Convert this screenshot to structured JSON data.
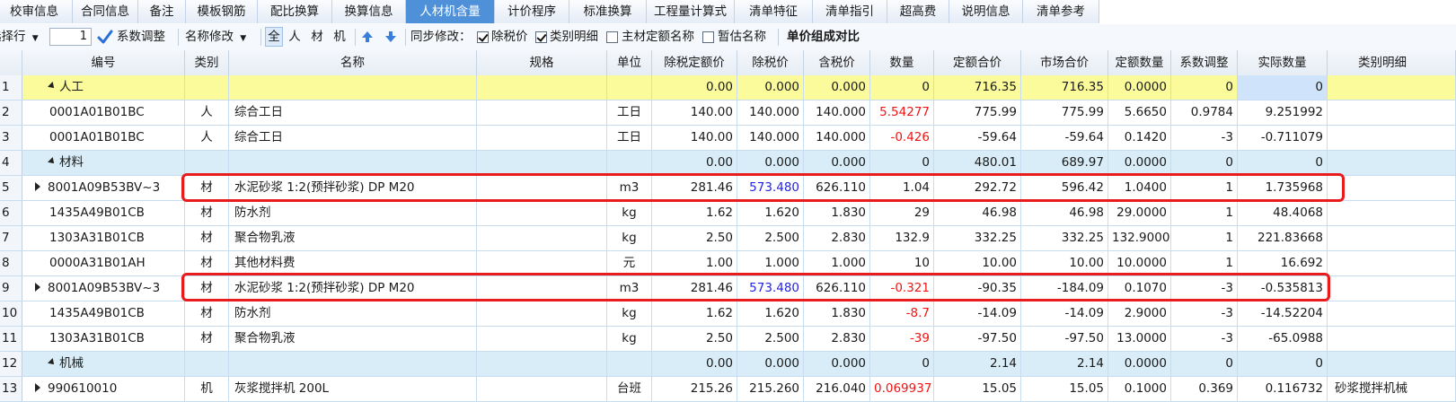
{
  "tabs": [
    {
      "label": "校审信息",
      "active": false
    },
    {
      "label": "合同信息",
      "active": false
    },
    {
      "label": "备注",
      "active": false
    },
    {
      "label": "模板钢筋",
      "active": false
    },
    {
      "label": "配比换算",
      "active": false
    },
    {
      "label": "换算信息",
      "active": false
    },
    {
      "label": "人材机含量",
      "active": true
    },
    {
      "label": "计价程序",
      "active": false
    },
    {
      "label": "标准换算",
      "active": false
    },
    {
      "label": "工程量计算式",
      "active": false
    },
    {
      "label": "清单特征",
      "active": false
    },
    {
      "label": "清单指引",
      "active": false
    },
    {
      "label": "超高费",
      "active": false
    },
    {
      "label": "说明信息",
      "active": false
    },
    {
      "label": "清单参考",
      "active": false
    }
  ],
  "toolbar": {
    "select_row_label": "选择行",
    "spin_value": "1",
    "coef_adjust_label": "系数调整",
    "rename_label": "名称修改",
    "filters": [
      "全",
      "人",
      "材",
      "机"
    ],
    "sync_label": "同步修改：",
    "checks": [
      {
        "label": "除税价",
        "checked": true
      },
      {
        "label": "类别明细",
        "checked": true
      },
      {
        "label": "主材定额名称",
        "checked": false
      },
      {
        "label": "暂估名称",
        "checked": false
      }
    ],
    "compare_label": "单价组成对比"
  },
  "columns": [
    "编号",
    "类别",
    "名称",
    "规格",
    "单位",
    "除税定额价",
    "除税价",
    "含税价",
    "数量",
    "定额合价",
    "市场合价",
    "定额数量",
    "系数调整",
    "实际数量",
    "类别明细"
  ],
  "rows": [
    {
      "n": "1",
      "code": "人工",
      "group": "rengong",
      "cat": "",
      "name": "",
      "spec": "",
      "unit": "",
      "base": "0.00",
      "price": "0.000",
      "tax": "0.000",
      "qty": "0",
      "qty_red": false,
      "quota_total": "716.35",
      "market_total": "716.35",
      "quota_qty": "0.0000",
      "coef": "0",
      "actual": "0",
      "detail": ""
    },
    {
      "n": "2",
      "code": "0001A01B01BC",
      "group": "",
      "cat": "人",
      "name": "综合工日",
      "spec": "",
      "unit": "工日",
      "base": "140.00",
      "price": "140.000",
      "tax": "140.000",
      "qty": "5.54277",
      "qty_red": true,
      "quota_total": "775.99",
      "market_total": "775.99",
      "quota_qty": "5.6650",
      "coef": "0.9784",
      "actual": "9.251992",
      "detail": ""
    },
    {
      "n": "3",
      "code": "0001A01B01BC",
      "group": "",
      "cat": "人",
      "name": "综合工日",
      "spec": "",
      "unit": "工日",
      "base": "140.00",
      "price": "140.000",
      "tax": "140.000",
      "qty": "-0.426",
      "qty_red": true,
      "quota_total": "-59.64",
      "market_total": "-59.64",
      "quota_qty": "0.1420",
      "coef": "-3",
      "actual": "-0.711079",
      "detail": ""
    },
    {
      "n": "4",
      "code": "材料",
      "group": "other",
      "cat": "",
      "name": "",
      "spec": "",
      "unit": "",
      "base": "0.00",
      "price": "0.000",
      "tax": "0.000",
      "qty": "0",
      "qty_red": false,
      "quota_total": "480.01",
      "market_total": "689.97",
      "quota_qty": "0.0000",
      "coef": "0",
      "actual": "0",
      "detail": ""
    },
    {
      "n": "5",
      "code": "8001A09B53BV~3",
      "group": "",
      "expand": true,
      "cat": "材",
      "name": "水泥砂浆 1:2(预拌砂浆)  DP M20",
      "spec": "",
      "unit": "m3",
      "base": "281.46",
      "price": "573.480",
      "price_blue": true,
      "tax": "626.110",
      "qty": "1.04",
      "qty_red": false,
      "quota_total": "292.72",
      "market_total": "596.42",
      "quota_qty": "1.0400",
      "coef": "1",
      "actual": "1.735968",
      "detail": ""
    },
    {
      "n": "6",
      "code": "1435A49B01CB",
      "group": "",
      "cat": "材",
      "name": "防水剂",
      "spec": "",
      "unit": "kg",
      "base": "1.62",
      "price": "1.620",
      "tax": "1.830",
      "qty": "29",
      "qty_red": false,
      "quota_total": "46.98",
      "market_total": "46.98",
      "quota_qty": "29.0000",
      "coef": "1",
      "actual": "48.4068",
      "detail": ""
    },
    {
      "n": "7",
      "code": "1303A31B01CB",
      "group": "",
      "cat": "材",
      "name": "聚合物乳液",
      "spec": "",
      "unit": "kg",
      "base": "2.50",
      "price": "2.500",
      "tax": "2.830",
      "qty": "132.9",
      "qty_red": false,
      "quota_total": "332.25",
      "market_total": "332.25",
      "quota_qty": "132.9000",
      "coef": "1",
      "actual": "221.83668",
      "detail": ""
    },
    {
      "n": "8",
      "code": "0000A31B01AH",
      "group": "",
      "cat": "材",
      "name": "其他材料费",
      "spec": "",
      "unit": "元",
      "base": "1.00",
      "price": "1.000",
      "tax": "1.000",
      "qty": "10",
      "qty_red": false,
      "quota_total": "10.00",
      "market_total": "10.00",
      "quota_qty": "10.0000",
      "coef": "1",
      "actual": "16.692",
      "detail": ""
    },
    {
      "n": "9",
      "code": "8001A09B53BV~3",
      "group": "",
      "expand": true,
      "cat": "材",
      "name": "水泥砂浆 1:2(预拌砂浆)  DP M20",
      "spec": "",
      "unit": "m3",
      "base": "281.46",
      "price": "573.480",
      "price_blue": true,
      "tax": "626.110",
      "qty": "-0.321",
      "qty_red": true,
      "quota_total": "-90.35",
      "market_total": "-184.09",
      "quota_qty": "0.1070",
      "coef": "-3",
      "actual": "-0.535813",
      "detail": ""
    },
    {
      "n": "10",
      "code": "1435A49B01CB",
      "group": "",
      "cat": "材",
      "name": "防水剂",
      "spec": "",
      "unit": "kg",
      "base": "1.62",
      "price": "1.620",
      "tax": "1.830",
      "qty": "-8.7",
      "qty_red": true,
      "quota_total": "-14.09",
      "market_total": "-14.09",
      "quota_qty": "2.9000",
      "coef": "-3",
      "actual": "-14.52204",
      "detail": ""
    },
    {
      "n": "11",
      "code": "1303A31B01CB",
      "group": "",
      "cat": "材",
      "name": "聚合物乳液",
      "spec": "",
      "unit": "kg",
      "base": "2.50",
      "price": "2.500",
      "tax": "2.830",
      "qty": "-39",
      "qty_red": true,
      "quota_total": "-97.50",
      "market_total": "-97.50",
      "quota_qty": "13.0000",
      "coef": "-3",
      "actual": "-65.0988",
      "detail": ""
    },
    {
      "n": "12",
      "code": "机械",
      "group": "other",
      "cat": "",
      "name": "",
      "spec": "",
      "unit": "",
      "base": "0.00",
      "price": "0.000",
      "tax": "0.000",
      "qty": "0",
      "qty_red": false,
      "quota_total": "2.14",
      "market_total": "2.14",
      "quota_qty": "0.0000",
      "coef": "0",
      "actual": "0",
      "detail": ""
    },
    {
      "n": "13",
      "code": "990610010",
      "group": "",
      "expand": true,
      "cat": "机",
      "name": "灰浆搅拌机 200L",
      "spec": "",
      "unit": "台班",
      "base": "215.26",
      "price": "215.260",
      "tax": "216.040",
      "qty": "0.069937",
      "qty_red": true,
      "quota_total": "15.05",
      "market_total": "15.05",
      "quota_qty": "0.1000",
      "coef": "0.369",
      "actual": "0.116732",
      "detail": "砂浆搅拌机械"
    }
  ],
  "colors": {
    "active_tab": "#4f91d9",
    "labor_row": "#fbfb9c",
    "group_row": "#d8edf7",
    "negative": "#f01414",
    "price_blue": "#2323e6",
    "highlight_box": "#e81c1c"
  }
}
